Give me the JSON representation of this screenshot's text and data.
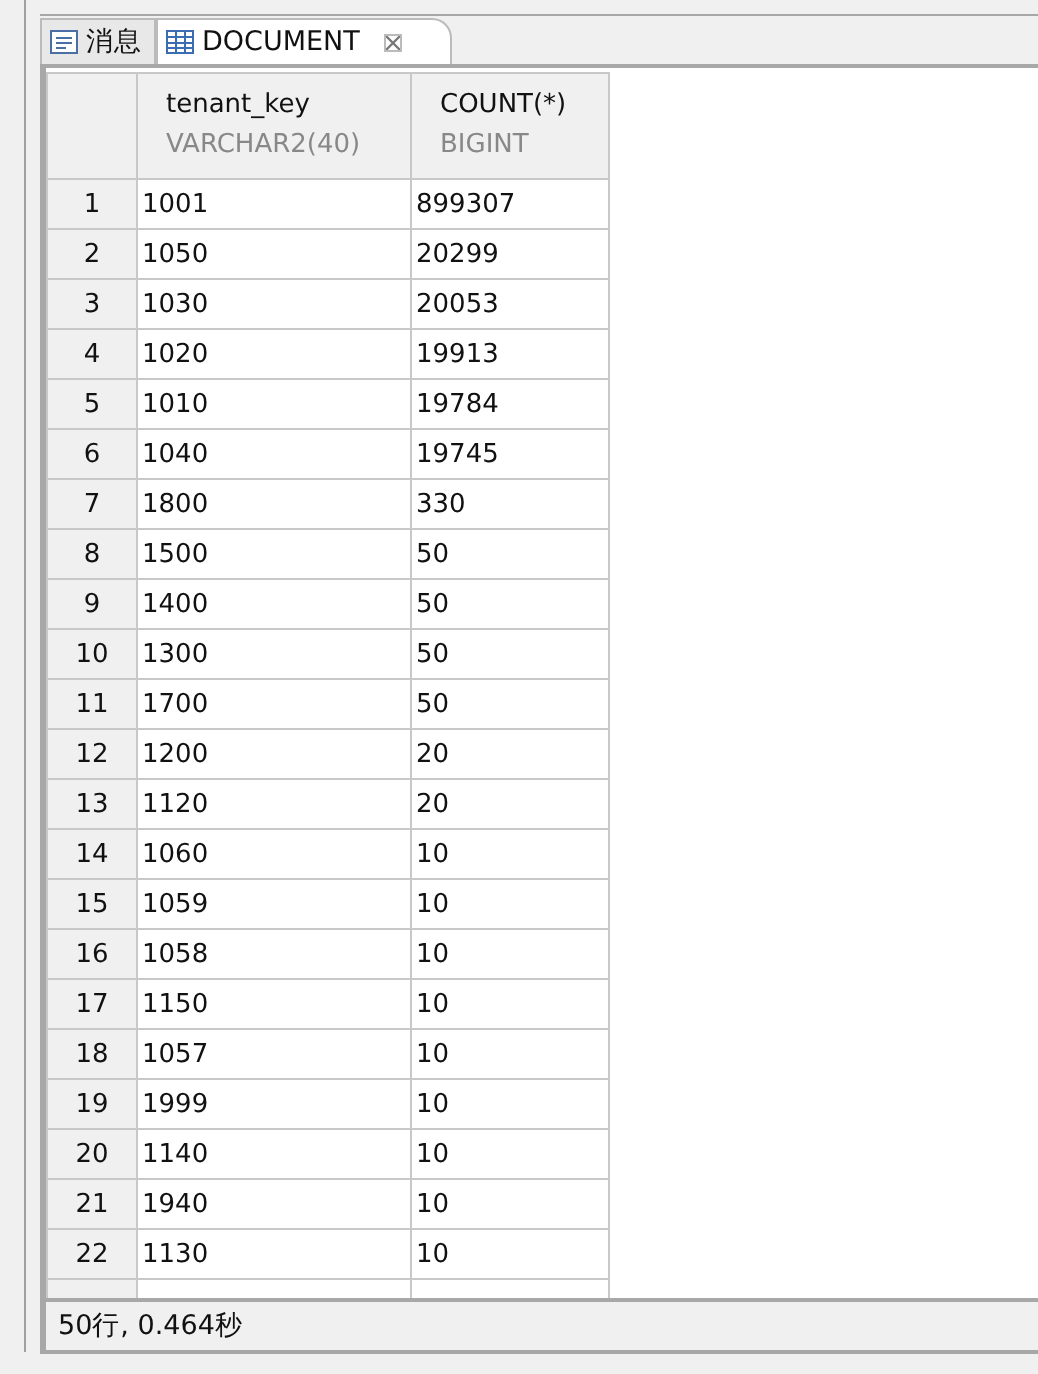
{
  "tabs": [
    {
      "label": "消息",
      "kind": "messages",
      "selected": false,
      "closable": false
    },
    {
      "label": "DOCUMENT",
      "kind": "grid",
      "selected": true,
      "closable": true
    }
  ],
  "table": {
    "columns": [
      {
        "name": "tenant_key",
        "type": "VARCHAR2(40)"
      },
      {
        "name": "COUNT(*)",
        "type": "BIGINT"
      }
    ],
    "rows": [
      {
        "number": "1",
        "cells": [
          "1001",
          "899307"
        ]
      },
      {
        "number": "2",
        "cells": [
          "1050",
          "20299"
        ]
      },
      {
        "number": "3",
        "cells": [
          "1030",
          "20053"
        ]
      },
      {
        "number": "4",
        "cells": [
          "1020",
          "19913"
        ]
      },
      {
        "number": "5",
        "cells": [
          "1010",
          "19784"
        ]
      },
      {
        "number": "6",
        "cells": [
          "1040",
          "19745"
        ]
      },
      {
        "number": "7",
        "cells": [
          "1800",
          "330"
        ]
      },
      {
        "number": "8",
        "cells": [
          "1500",
          "50"
        ]
      },
      {
        "number": "9",
        "cells": [
          "1400",
          "50"
        ]
      },
      {
        "number": "10",
        "cells": [
          "1300",
          "50"
        ]
      },
      {
        "number": "11",
        "cells": [
          "1700",
          "50"
        ]
      },
      {
        "number": "12",
        "cells": [
          "1200",
          "20"
        ]
      },
      {
        "number": "13",
        "cells": [
          "1120",
          "20"
        ]
      },
      {
        "number": "14",
        "cells": [
          "1060",
          "10"
        ]
      },
      {
        "number": "15",
        "cells": [
          "1059",
          "10"
        ]
      },
      {
        "number": "16",
        "cells": [
          "1058",
          "10"
        ]
      },
      {
        "number": "17",
        "cells": [
          "1150",
          "10"
        ]
      },
      {
        "number": "18",
        "cells": [
          "1057",
          "10"
        ]
      },
      {
        "number": "19",
        "cells": [
          "1999",
          "10"
        ]
      },
      {
        "number": "20",
        "cells": [
          "1140",
          "10"
        ]
      },
      {
        "number": "21",
        "cells": [
          "1940",
          "10"
        ]
      },
      {
        "number": "22",
        "cells": [
          "1130",
          "10"
        ]
      }
    ]
  },
  "status_bar": "50行, 0.464秒"
}
